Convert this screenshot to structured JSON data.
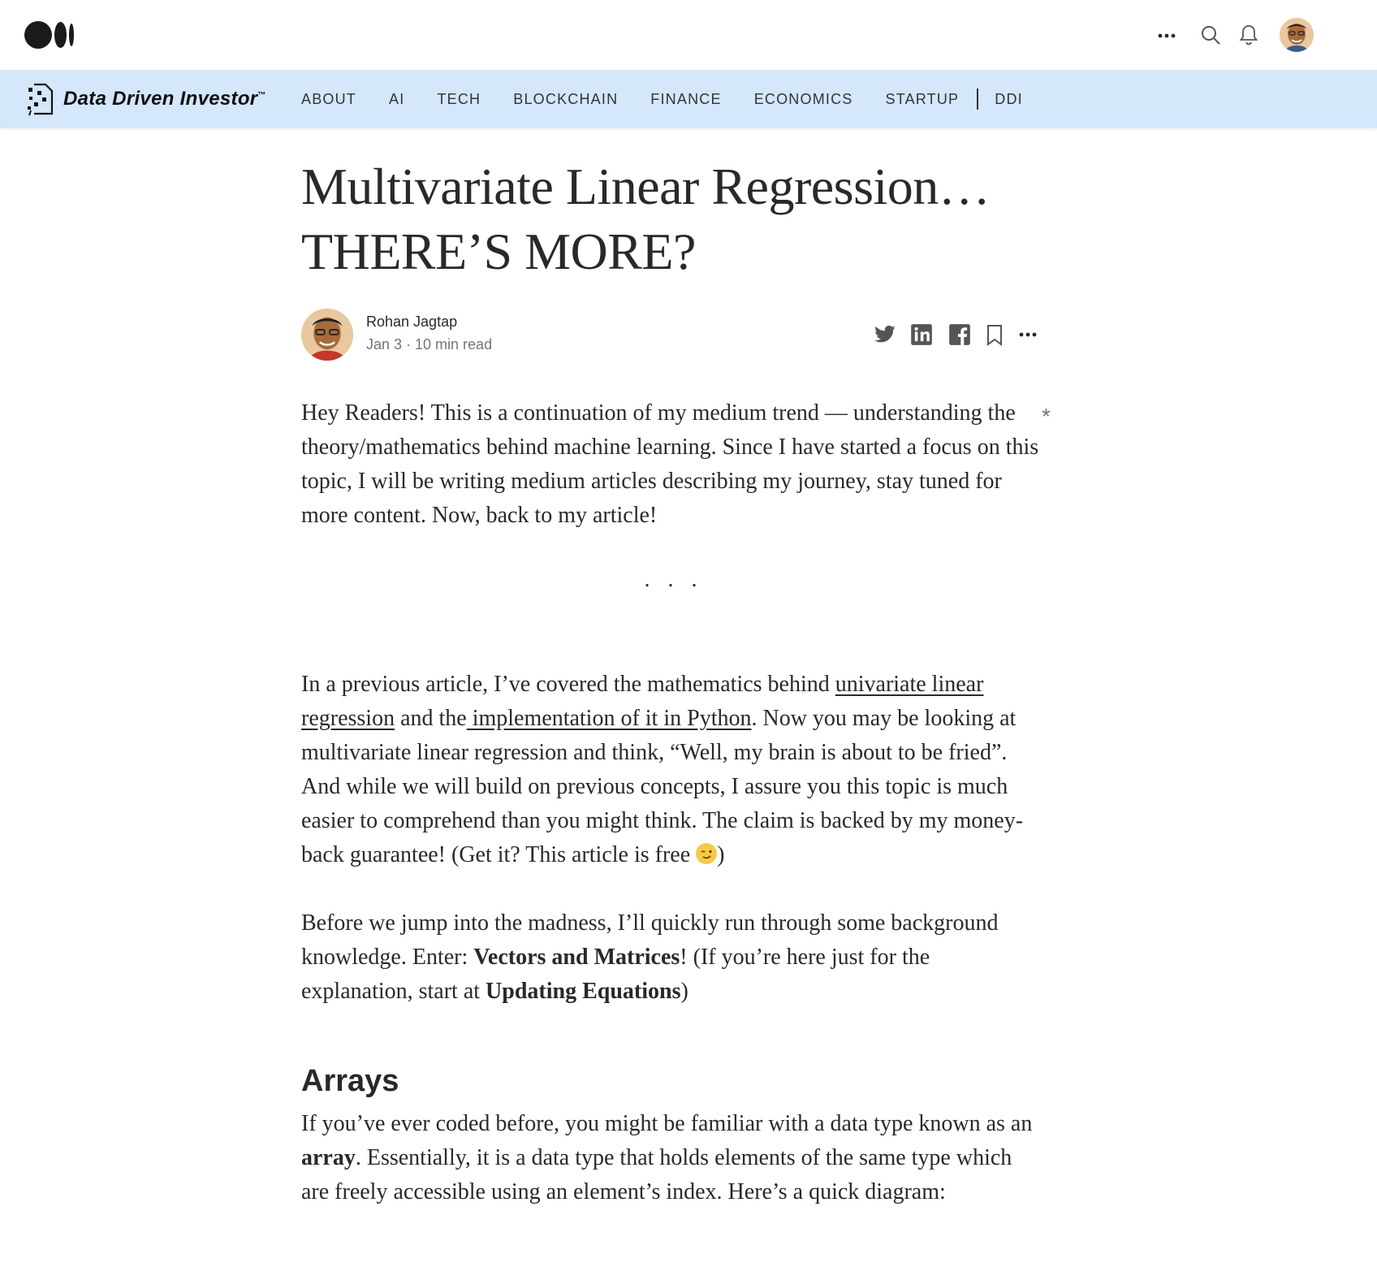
{
  "topbar": {
    "logo_name": "medium-logo",
    "more_icon": "more-horizontal-icon",
    "search_icon": "search-icon",
    "notifications_icon": "bell-icon"
  },
  "publication": {
    "name": "Data Driven Investor",
    "tm": "™",
    "nav": [
      "ABOUT",
      "AI",
      "TECH",
      "BLOCKCHAIN",
      "FINANCE",
      "ECONOMICS",
      "STARTUP",
      "DDI"
    ]
  },
  "article": {
    "title_line1": "Multivariate Linear Regression…",
    "title_line2": "THERE’S MORE?",
    "author": "Rohan Jagtap",
    "meta": "Jan 3 · 10 min read",
    "share_icons": [
      "twitter-icon",
      "linkedin-icon",
      "facebook-icon",
      "bookmark-icon",
      "more-horizontal-icon"
    ],
    "intro": "Hey Readers! This is a continuation of my medium trend — understanding the theory/mathematics behind machine learning. Since I have started a focus on this topic, I will be writing medium articles describing my journey, stay tuned for more content. Now, back to my article!",
    "star": "*",
    "separator": "...",
    "p2_a": "In a previous article, I’ve covered the mathematics behind ",
    "p2_link1": "univariate linear regression",
    "p2_b": " and the",
    "p2_link2": " implementation of it in Python",
    "p2_c": ". Now you may be looking at multivariate linear regression and think, “Well, my brain is about to be fried”. And while we will build on previous concepts, I assure you this topic is much easier to comprehend than you might think. The claim is backed by my money-back guarantee! (Get it? This article is free ",
    "p2_end": ")",
    "p3_a": "Before we jump into the madness, I’ll quickly run through some background knowledge. Enter: ",
    "p3_bold1": "Vectors and Matrices",
    "p3_b": "! (If you’re here just for the explanation, start at ",
    "p3_bold2": "Updating Equations",
    "p3_c": ")",
    "section_heading": "Arrays",
    "p4_a": "If you’ve ever coded before, you might be familiar with a data type known as an ",
    "p4_bold": "array",
    "p4_b": ". Essentially, it is a data type that holds elements of the same type which are freely accessible using an element’s index. Here’s a quick diagram:"
  }
}
